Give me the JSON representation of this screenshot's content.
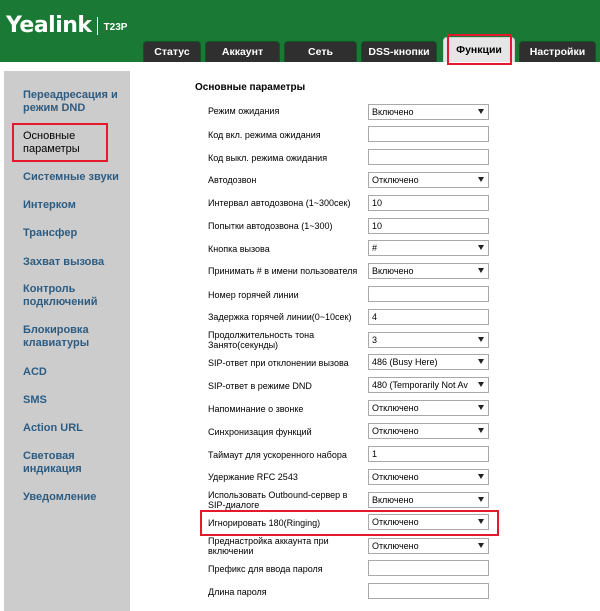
{
  "brand": {
    "name": "Yealink",
    "model": "T23P"
  },
  "tabs": [
    {
      "label": "Статус",
      "active": false
    },
    {
      "label": "Аккаунт",
      "active": false
    },
    {
      "label": "Сеть",
      "active": false
    },
    {
      "label": "DSS-кнопки",
      "active": false
    },
    {
      "label": "Функции",
      "active": true
    },
    {
      "label": "Настройки",
      "active": false
    }
  ],
  "sidebar": {
    "items": [
      {
        "label": "Переадресация и режим DND",
        "active": false
      },
      {
        "label": "Основные параметры",
        "active": true
      },
      {
        "label": "Системные звуки",
        "active": false
      },
      {
        "label": "Интерком",
        "active": false
      },
      {
        "label": "Трансфер",
        "active": false
      },
      {
        "label": "Захват вызова",
        "active": false
      },
      {
        "label": "Контроль подключений",
        "active": false
      },
      {
        "label": "Блокировка клавиатуры",
        "active": false
      },
      {
        "label": "ACD",
        "active": false
      },
      {
        "label": "SMS",
        "active": false
      },
      {
        "label": "Action URL",
        "active": false
      },
      {
        "label": "Световая индикация",
        "active": false
      },
      {
        "label": "Уведомление",
        "active": false
      }
    ]
  },
  "main": {
    "section_title": "Основные параметры",
    "rows": [
      {
        "label": "Режим ожидания",
        "type": "select",
        "value": "Включено"
      },
      {
        "label": "Код вкл. режима ожидания",
        "type": "input",
        "value": ""
      },
      {
        "label": "Код выкл. режима ожидания",
        "type": "input",
        "value": ""
      },
      {
        "label": "Автодозвон",
        "type": "select",
        "value": "Отключено"
      },
      {
        "label": "Интервал автодозвона (1~300сек)",
        "type": "input",
        "value": "10"
      },
      {
        "label": "Попытки автодозвона (1~300)",
        "type": "input",
        "value": "10"
      },
      {
        "label": "Кнопка вызова",
        "type": "select",
        "value": "#"
      },
      {
        "label": "Принимать # в имени пользователя",
        "type": "select",
        "value": "Включено"
      },
      {
        "label": "Номер горячей линии",
        "type": "input",
        "value": ""
      },
      {
        "label": "Задержка горячей линии(0~10сек)",
        "type": "input",
        "value": "4"
      },
      {
        "label": "Продолжительность тона Занято(секунды)",
        "type": "select",
        "value": "3"
      },
      {
        "label": "SIP-ответ при отклонении вызова",
        "type": "select",
        "value": "486 (Busy Here)"
      },
      {
        "label": "SIP-ответ в режиме DND",
        "type": "select",
        "value": "480 (Temporarily Not Av"
      },
      {
        "label": "Напоминание о звонке",
        "type": "select",
        "value": "Отключено"
      },
      {
        "label": "Синхронизация функций",
        "type": "select",
        "value": "Отключено"
      },
      {
        "label": "Таймаут для ускоренного набора",
        "type": "input",
        "value": "1"
      },
      {
        "label": "Удержание RFC 2543",
        "type": "select",
        "value": "Отключено"
      },
      {
        "label": "Использовать Outbound-сервер в SIP-диалоге",
        "type": "select",
        "value": "Включено"
      },
      {
        "label": "Игнорировать 180(Ringing)",
        "type": "select",
        "value": "Отключено"
      },
      {
        "label": "Преднастройка аккаунта при включении",
        "type": "select",
        "value": "Отключено"
      },
      {
        "label": "Префикс для ввода пароля",
        "type": "input",
        "value": ""
      },
      {
        "label": "Длина пароля",
        "type": "input",
        "value": ""
      }
    ]
  },
  "colors": {
    "header_green": "#1a7a35",
    "highlight_red": "#e5192c",
    "sidebar_bg": "#cccccc",
    "link_blue": "#2d5c82"
  }
}
